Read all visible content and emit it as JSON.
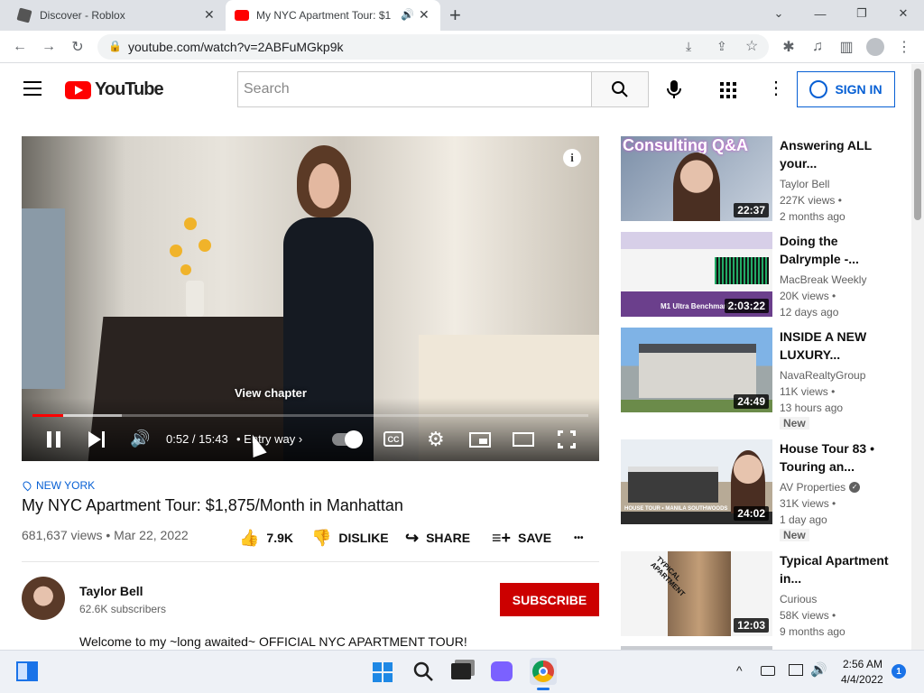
{
  "browser": {
    "tabs": [
      {
        "title": "Discover - Roblox"
      },
      {
        "title": "My NYC Apartment Tour: $1"
      }
    ],
    "new_tab": "+",
    "url": "youtube.com/watch?v=2ABFuMGkp9k"
  },
  "youtube": {
    "logo_text": "YouTube",
    "search_placeholder": "Search",
    "sign_in_label": "SIGN IN"
  },
  "player": {
    "time": "0:52 / 15:43",
    "chapter": "Entry way",
    "tooltip": "View chapter",
    "progress_fraction": 0.055,
    "buffer_fraction": 0.16
  },
  "video": {
    "location": "NEW YORK",
    "title": "My NYC Apartment Tour: $1,875/Month in Manhattan",
    "views_date": "681,637 views • Mar 22, 2022",
    "like_count": "7.9K",
    "dislike_label": "DISLIKE",
    "share_label": "SHARE",
    "save_label": "SAVE",
    "more_label": "•••",
    "channel_name": "Taylor Bell",
    "subscribers": "62.6K subscribers",
    "subscribe_label": "SUBSCRIBE",
    "description": "Welcome to my ~long awaited~ OFFICIAL NYC APARTMENT TOUR!"
  },
  "recommendations": [
    {
      "title": "Answering ALL your...",
      "channel": "Taylor Bell",
      "views": "227K views •",
      "age": "2 months ago",
      "duration": "22:37",
      "badge": "",
      "verified": false,
      "thumb_text": "Consulting Q&A"
    },
    {
      "title": "Doing the Dalrymple -...",
      "channel": "MacBreak Weekly",
      "views": "20K views •",
      "age": "12 days ago",
      "duration": "2:03:22",
      "badge": "",
      "verified": false,
      "thumb_text": "M1 Ultra Benchmark"
    },
    {
      "title": "INSIDE A NEW LUXURY...",
      "channel": "NavaRealtyGroup",
      "views": "11K views •",
      "age": "13 hours ago",
      "duration": "24:49",
      "badge": "New",
      "verified": false,
      "thumb_text": ""
    },
    {
      "title": "House Tour 83 • Touring an...",
      "channel": "AV Properties",
      "views": "31K views •",
      "age": "1 day ago",
      "duration": "24:02",
      "badge": "New",
      "verified": true,
      "thumb_text": "HOUSE TOUR • MANILA SOUTHWOODS"
    },
    {
      "title": "Typical Apartment in...",
      "channel": "Curious",
      "views": "58K views •",
      "age": "9 months ago",
      "duration": "12:03",
      "badge": "",
      "verified": false,
      "thumb_text": "TYPICAL APARTMENT"
    }
  ],
  "taskbar": {
    "time": "2:56 AM",
    "date": "4/4/2022",
    "notification_count": "1"
  }
}
